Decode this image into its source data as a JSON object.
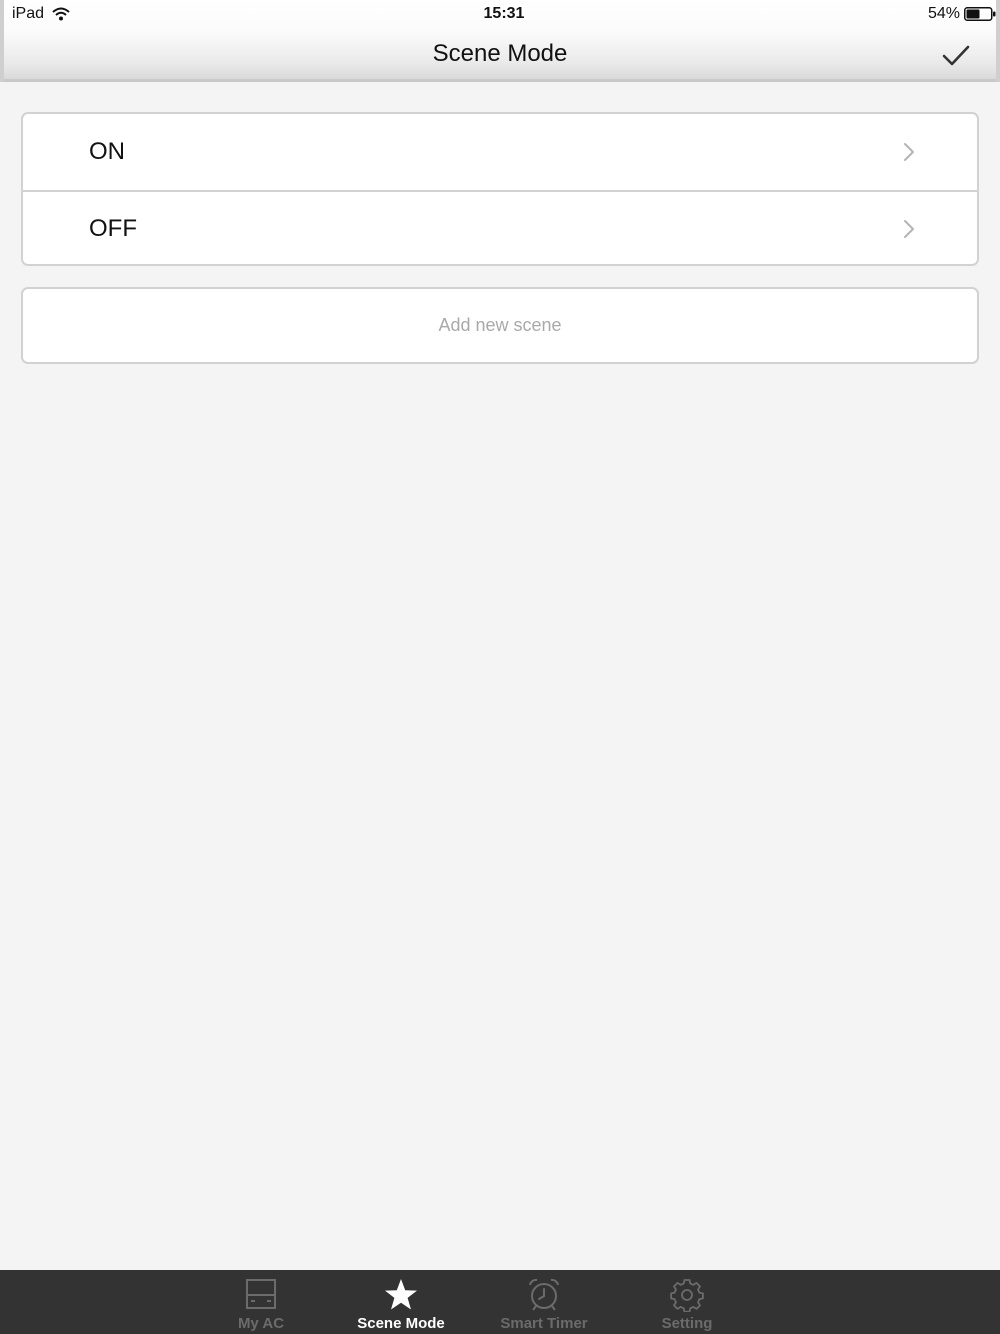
{
  "status_bar": {
    "device": "iPad",
    "time": "15:31",
    "battery_percent": "54%",
    "battery_level": 0.54
  },
  "nav": {
    "title": "Scene Mode",
    "done_icon": "checkmark-icon"
  },
  "scenes": [
    {
      "label": "ON",
      "icon": "chevron-right-icon"
    },
    {
      "label": "OFF",
      "icon": "chevron-right-icon"
    }
  ],
  "add_scene": {
    "label": "Add new scene"
  },
  "tabs": [
    {
      "label": "My AC",
      "icon": "ac-unit-icon",
      "active": false
    },
    {
      "label": "Scene Mode",
      "icon": "star-icon",
      "active": true
    },
    {
      "label": "Smart Timer",
      "icon": "alarm-clock-icon",
      "active": false
    },
    {
      "label": "Setting",
      "icon": "gear-icon",
      "active": false
    }
  ],
  "colors": {
    "background": "#f4f4f4",
    "tab_bar": "#333333",
    "tab_active": "#ffffff",
    "tab_inactive": "#6b6b6b",
    "placeholder_text": "#a9a9a9"
  }
}
